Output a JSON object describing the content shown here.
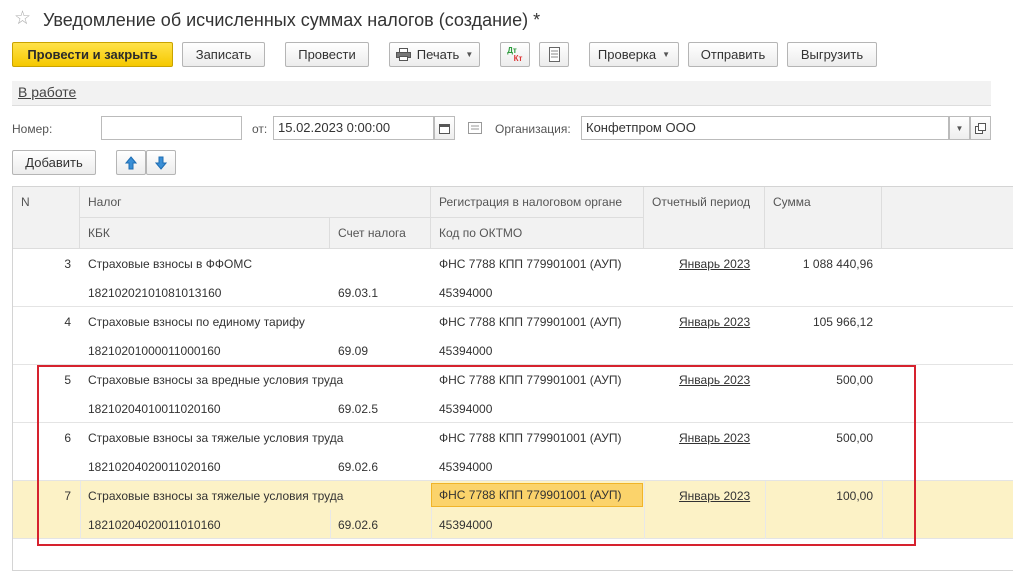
{
  "window": {
    "title": "Уведомление об исчисленных суммах налогов (создание) *"
  },
  "toolbar": {
    "post_close": "Провести и закрыть",
    "save": "Записать",
    "post": "Провести",
    "print": "Печать",
    "dtkt_top": "Дт",
    "dtkt_bottom": "Кт",
    "check": "Проверка",
    "send": "Отправить",
    "export": "Выгрузить"
  },
  "status": {
    "label": "В работе"
  },
  "form": {
    "number_label": "Номер:",
    "number_value": "",
    "date_label": "от:",
    "date_value": "15.02.2023  0:00:00",
    "org_label": "Организация:",
    "org_value": "Конфетпром ООО"
  },
  "table_toolbar": {
    "add": "Добавить"
  },
  "table": {
    "headers": {
      "n": "N",
      "tax": "Налог",
      "kbk": "КБК",
      "account": "Счет налога",
      "registration": "Регистрация в налоговом органе",
      "oktmo": "Код по ОКТМО",
      "period": "Отчетный период",
      "sum": "Сумма"
    },
    "rows": [
      {
        "n": "3",
        "tax": "Страховые взносы в ФФОМС",
        "kbk": "18210202101081013160",
        "account": "69.03.1",
        "registration": "ФНС 7788 КПП 779901001 (АУП)",
        "oktmo": "45394000",
        "period": "Январь 2023",
        "sum": "1 088 440,96"
      },
      {
        "n": "4",
        "tax": "Страховые взносы по единому тарифу",
        "kbk": "18210201000011000160",
        "account": "69.09",
        "registration": "ФНС 7788 КПП 779901001 (АУП)",
        "oktmo": "45394000",
        "period": "Январь 2023",
        "sum": "105 966,12"
      },
      {
        "n": "5",
        "tax": "Страховые взносы за вредные условия труда",
        "kbk": "18210204010011020160",
        "account": "69.02.5",
        "registration": "ФНС 7788 КПП 779901001 (АУП)",
        "oktmo": "45394000",
        "period": "Январь 2023",
        "sum": "500,00"
      },
      {
        "n": "6",
        "tax": "Страховые взносы за тяжелые условия труда",
        "kbk": "18210204020011020160",
        "account": "69.02.6",
        "registration": "ФНС 7788 КПП 779901001 (АУП)",
        "oktmo": "45394000",
        "period": "Январь 2023",
        "sum": "500,00"
      },
      {
        "n": "7",
        "tax": "Страховые взносы за тяжелые условия труда",
        "kbk": "18210204020011010160",
        "account": "69.02.6",
        "registration": "ФНС 7788 КПП 779901001 (АУП)",
        "oktmo": "45394000",
        "period": "Январь 2023",
        "sum": "100,00"
      }
    ]
  },
  "colors": {
    "primary_button": "#f5c800",
    "selected_row": "#fcf2c6",
    "highlight_box": "#d6222e",
    "arrow_blue": "#3a8fd6"
  }
}
